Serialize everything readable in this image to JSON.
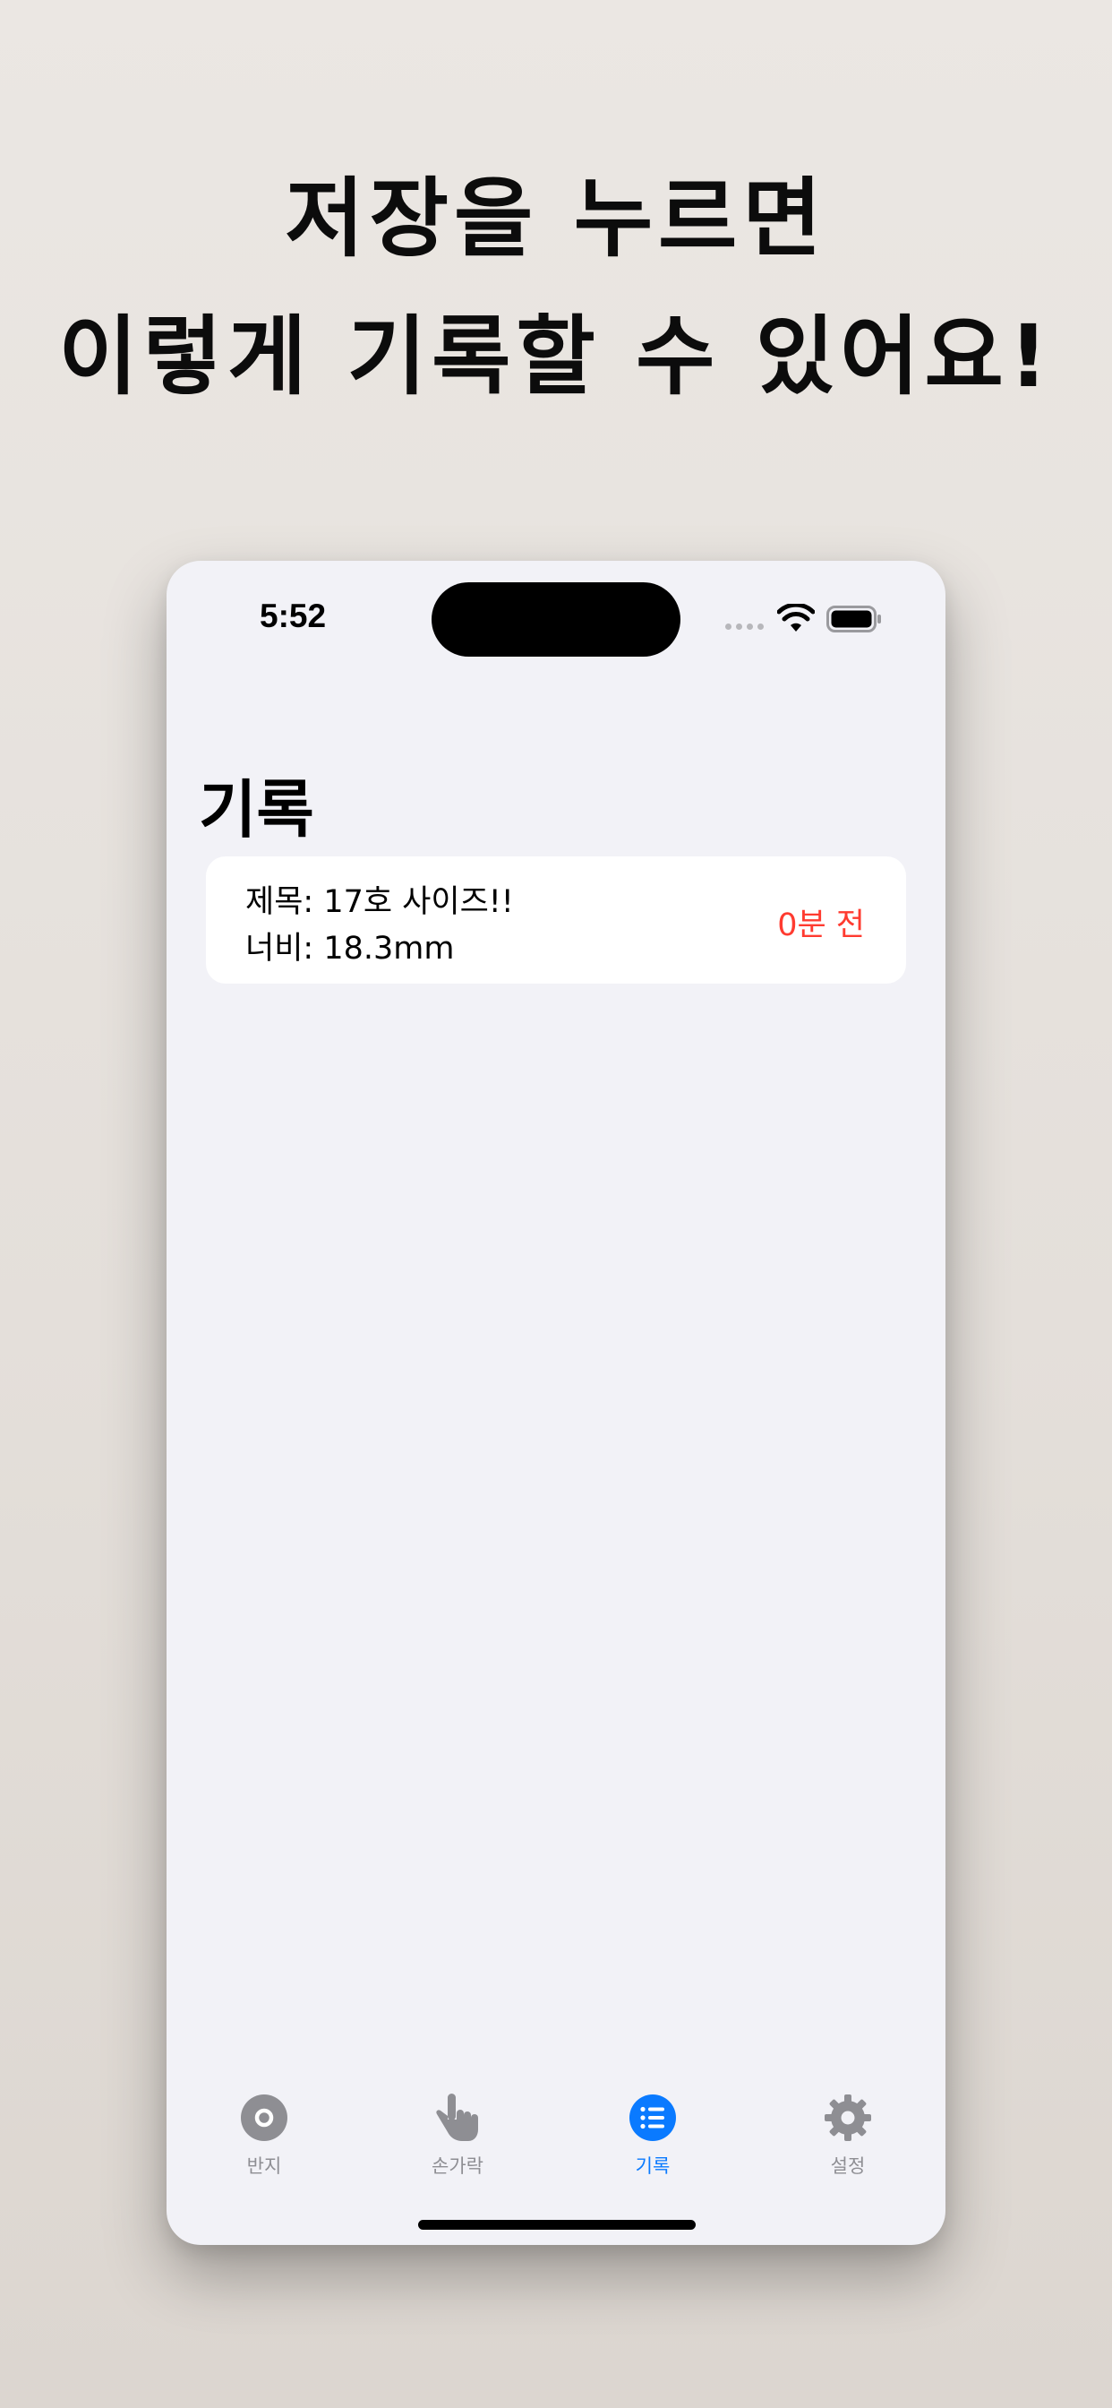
{
  "promo": {
    "line1": "저장을 누르면",
    "line2": "이렇게 기록할 수 있어요!"
  },
  "status_bar": {
    "time": "5:52"
  },
  "screen": {
    "title": "기록"
  },
  "records": [
    {
      "title": "제목: 17호 사이즈!!",
      "width": "너비: 18.3mm",
      "time": "0분 전"
    }
  ],
  "tabs": [
    {
      "label": "반지",
      "icon": "ring-icon",
      "active": false
    },
    {
      "label": "손가락",
      "icon": "finger-pointing-icon",
      "active": false
    },
    {
      "label": "기록",
      "icon": "list-icon",
      "active": true
    },
    {
      "label": "설정",
      "icon": "gear-icon",
      "active": false
    }
  ],
  "colors": {
    "accent": "#0a7aff",
    "time_text": "#ff3b30",
    "inactive_tab": "#8e8e93",
    "screen_background": "#f2f2f7"
  }
}
